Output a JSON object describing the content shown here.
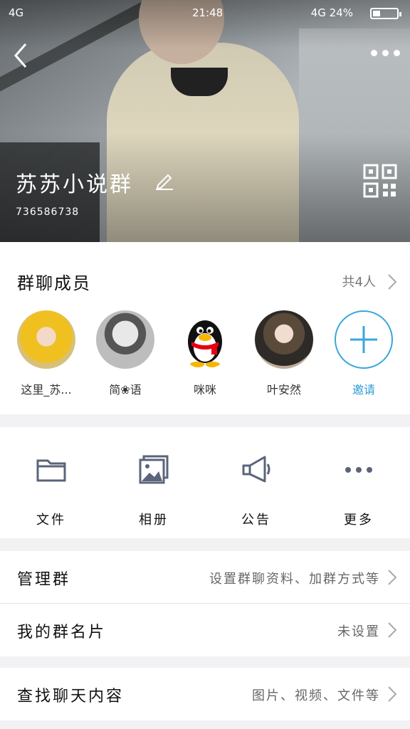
{
  "status_bar": {
    "network_left": "4G",
    "time": "21:48",
    "network_right": "4G",
    "battery": "24%"
  },
  "header": {
    "group_name": "苏苏小说群",
    "group_id": "736586738"
  },
  "members": {
    "title": "群聊成员",
    "count": "共4人",
    "list": [
      {
        "name": "这里_苏...",
        "avatar": "yellow-hood-girl"
      },
      {
        "name": "简❀语",
        "avatar": "bw-boy"
      },
      {
        "name": "咪咪",
        "avatar": "qq-penguin-icon"
      },
      {
        "name": "叶安然",
        "avatar": "brown-hair-girl"
      }
    ],
    "invite_label": "邀请"
  },
  "features": [
    {
      "label": "文件",
      "icon": "folder-icon"
    },
    {
      "label": "相册",
      "icon": "album-icon"
    },
    {
      "label": "公告",
      "icon": "megaphone-icon"
    },
    {
      "label": "更多",
      "icon": "more-dots-icon"
    }
  ],
  "rows": {
    "manage": {
      "title": "管理群",
      "value": "设置群聊资料、加群方式等"
    },
    "card": {
      "title": "我的群名片",
      "value": "未设置"
    },
    "search": {
      "title": "查找聊天内容",
      "value": "图片、视频、文件等"
    }
  },
  "colors": {
    "accent": "#3aa6dc",
    "background": "#f2f2f4",
    "icon": "#5b6478"
  }
}
